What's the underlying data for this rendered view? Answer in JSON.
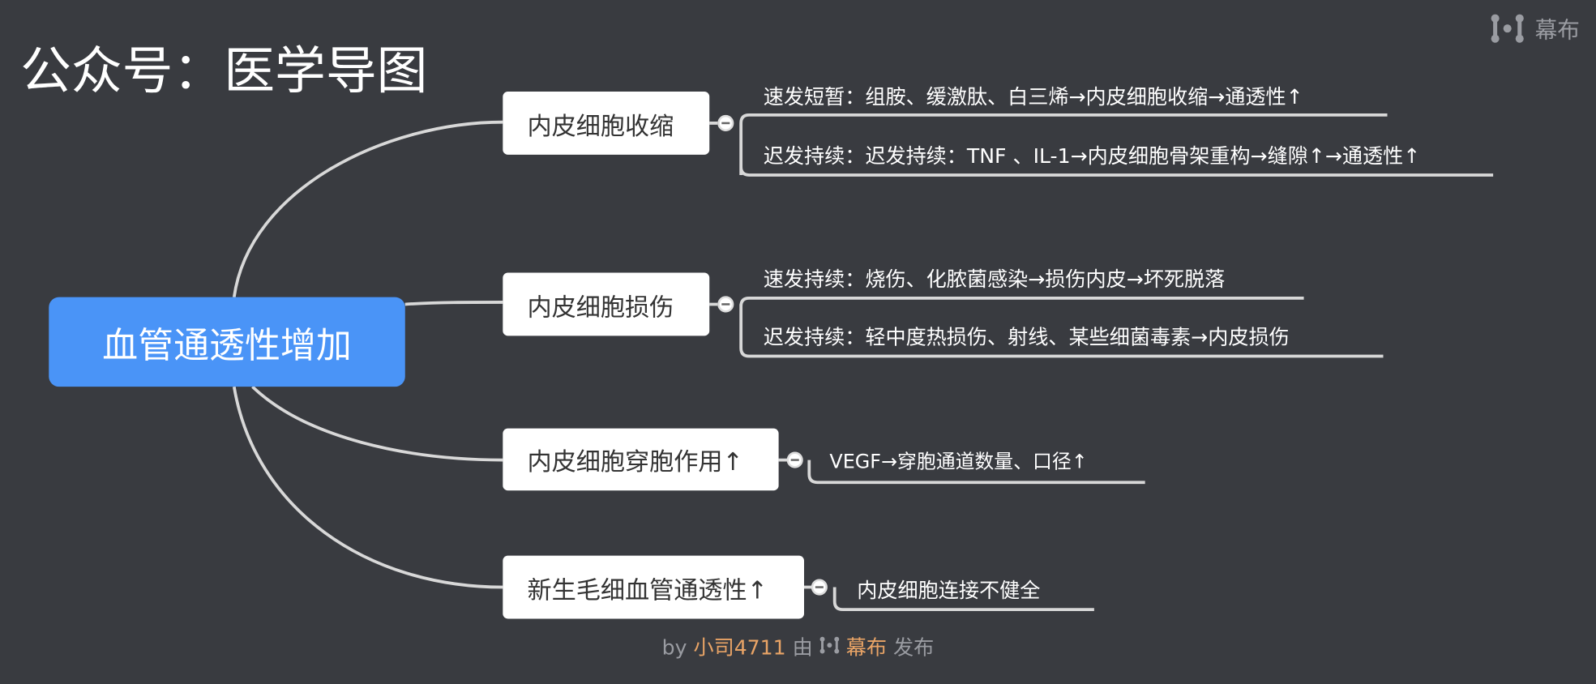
{
  "watermark": {
    "title": "公众号：医学导图",
    "brand": "幕布"
  },
  "colors": {
    "background": "#393b40",
    "root": "#4a94f7",
    "line": "#d8d8d8",
    "accent": "#e9a466"
  },
  "root": {
    "label": "血管通透性增加"
  },
  "branches": [
    {
      "label": "内皮细胞收缩",
      "children": [
        "速发短暂：组胺、缓激肽、白三烯→内皮细胞收缩→通透性↑",
        "迟发持续：迟发持续：TNF 、IL-1→内皮细胞骨架重构→缝隙↑→通透性↑"
      ]
    },
    {
      "label": "内皮细胞损伤",
      "children": [
        "速发持续：烧伤、化脓菌感染→损伤内皮→坏死脱落",
        "迟发持续：轻中度热损伤、射线、某些细菌毒素→内皮损伤"
      ]
    },
    {
      "label": "内皮细胞穿胞作用↑",
      "children": [
        "VEGF→穿胞通道数量、口径↑"
      ]
    },
    {
      "label": "新生毛细血管通透性↑",
      "children": [
        "内皮细胞连接不健全"
      ]
    }
  ],
  "footer": {
    "by": "by",
    "author": "小司4711",
    "via": "由",
    "brand": "幕布",
    "publish": "发布"
  }
}
